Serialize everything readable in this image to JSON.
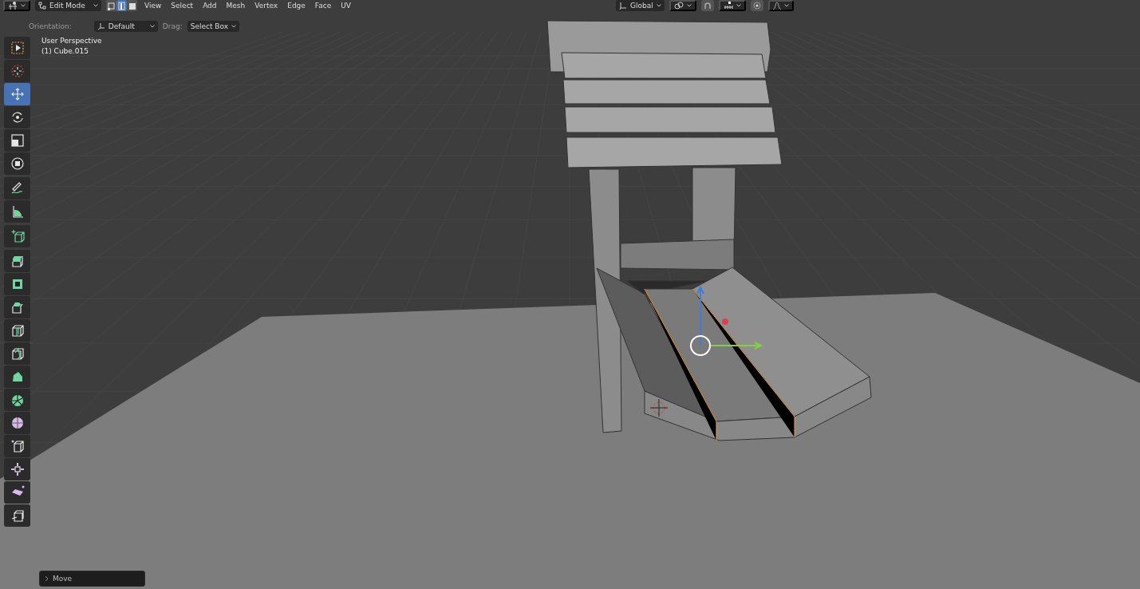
{
  "header": {
    "mode": "Edit Mode",
    "select_modes": [
      {
        "kind": "vertex",
        "selected": false
      },
      {
        "kind": "edge",
        "selected": true
      },
      {
        "kind": "face",
        "selected": false
      }
    ],
    "menus": [
      "View",
      "Select",
      "Add",
      "Mesh",
      "Vertex",
      "Edge",
      "Face",
      "UV"
    ],
    "orientation": "Global",
    "snap": {
      "on": false
    },
    "proportional": {
      "on": false
    }
  },
  "tool_settings": {
    "orientation_label": "Orientation:",
    "orientation": "Default",
    "drag_label": "Drag:",
    "drag": "Select Box"
  },
  "viewport": {
    "view_name": "User Perspective",
    "object": "(1) Cube.015"
  },
  "toolbar": {
    "groups": [
      [
        {
          "kind": "select-box",
          "selected": false
        },
        {
          "kind": "cursor",
          "selected": false
        },
        {
          "kind": "move",
          "selected": true
        },
        {
          "kind": "rotate",
          "selected": false
        },
        {
          "kind": "scale",
          "selected": false
        },
        {
          "kind": "transform",
          "selected": false
        }
      ],
      [
        {
          "kind": "annotate",
          "selected": false
        },
        {
          "kind": "measure",
          "selected": false
        }
      ],
      [
        {
          "kind": "add-cube",
          "selected": false
        }
      ],
      [
        {
          "kind": "extrude",
          "selected": false
        },
        {
          "kind": "inset",
          "selected": false
        },
        {
          "kind": "bevel",
          "selected": false
        },
        {
          "kind": "loop-cut",
          "selected": false
        },
        {
          "kind": "knife",
          "selected": false
        },
        {
          "kind": "poly-build",
          "selected": false
        },
        {
          "kind": "spin",
          "selected": false
        },
        {
          "kind": "smooth",
          "selected": false
        },
        {
          "kind": "edge-slide",
          "selected": false
        },
        {
          "kind": "shrink",
          "selected": false
        },
        {
          "kind": "shear",
          "selected": false
        },
        {
          "kind": "rip",
          "selected": false
        }
      ]
    ]
  },
  "operator_panel": {
    "title": "Move",
    "expanded": false
  }
}
